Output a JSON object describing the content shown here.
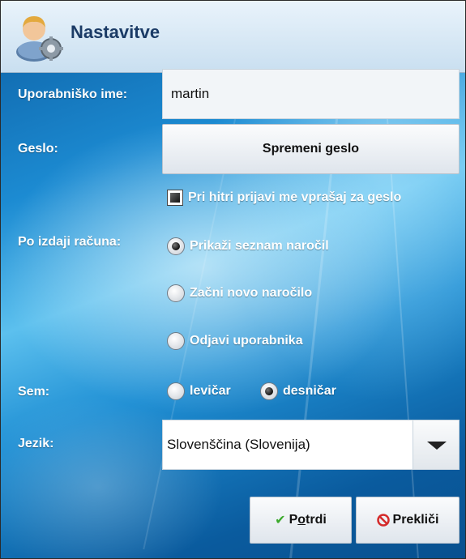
{
  "window": {
    "title": "Nastavitve",
    "icon": "user-settings-icon"
  },
  "form": {
    "username_label": "Uporabniško ime:",
    "username_value": "martin",
    "password_label": "Geslo:",
    "change_password_button": "Spremeni geslo",
    "quick_login_checkbox": {
      "label": "Pri hitri prijavi me vprašaj za geslo",
      "checked": true
    },
    "after_invoice_label": "Po izdaji računa:",
    "after_invoice_options": [
      {
        "label": "Prikaži seznam naročil",
        "selected": true
      },
      {
        "label": "Začni novo naročilo",
        "selected": false
      },
      {
        "label": "Odjavi uporabnika",
        "selected": false
      }
    ],
    "handedness_label": "Sem:",
    "handedness_options": [
      {
        "label": "levičar",
        "selected": false
      },
      {
        "label": "desničar",
        "selected": true
      }
    ],
    "language_label": "Jezik:",
    "language_value": "Slovenščina (Slovenija)"
  },
  "buttons": {
    "confirm": {
      "prefix": "P",
      "mnemonic": "o",
      "rest": "trdi",
      "icon": "checkmark-icon",
      "icon_color": "#3caa2c"
    },
    "cancel": {
      "label": "Prekliči",
      "icon": "cancel-icon",
      "icon_color": "#d42b2b"
    }
  }
}
